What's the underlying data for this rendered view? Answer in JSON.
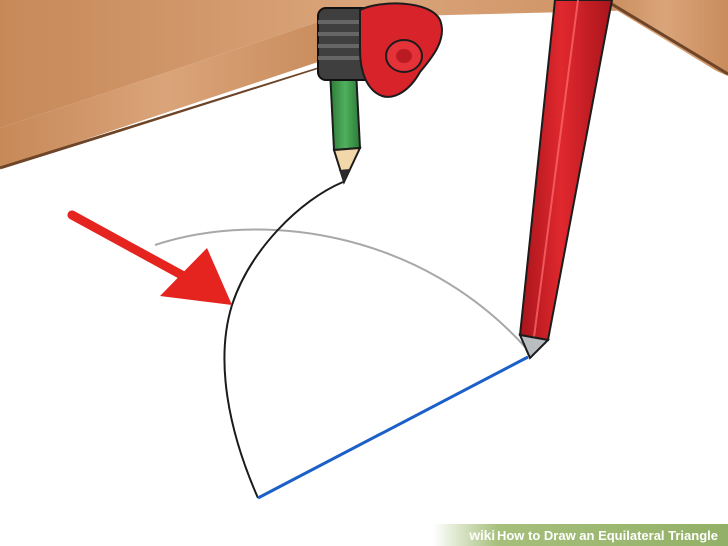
{
  "watermark": {
    "brand": "wiki",
    "title": "How to Draw an Equilateral Triangle"
  },
  "colors": {
    "table": "#d39a6c",
    "paper": "#ffffff",
    "compass_red": "#d8232a",
    "pencil_green": "#3f9a4c",
    "blue_line": "#1b5fc9",
    "arrow": "#e5231f",
    "guide_arc": "#a8a8a8"
  },
  "icons": [
    "compass",
    "pencil",
    "red-arrow"
  ]
}
